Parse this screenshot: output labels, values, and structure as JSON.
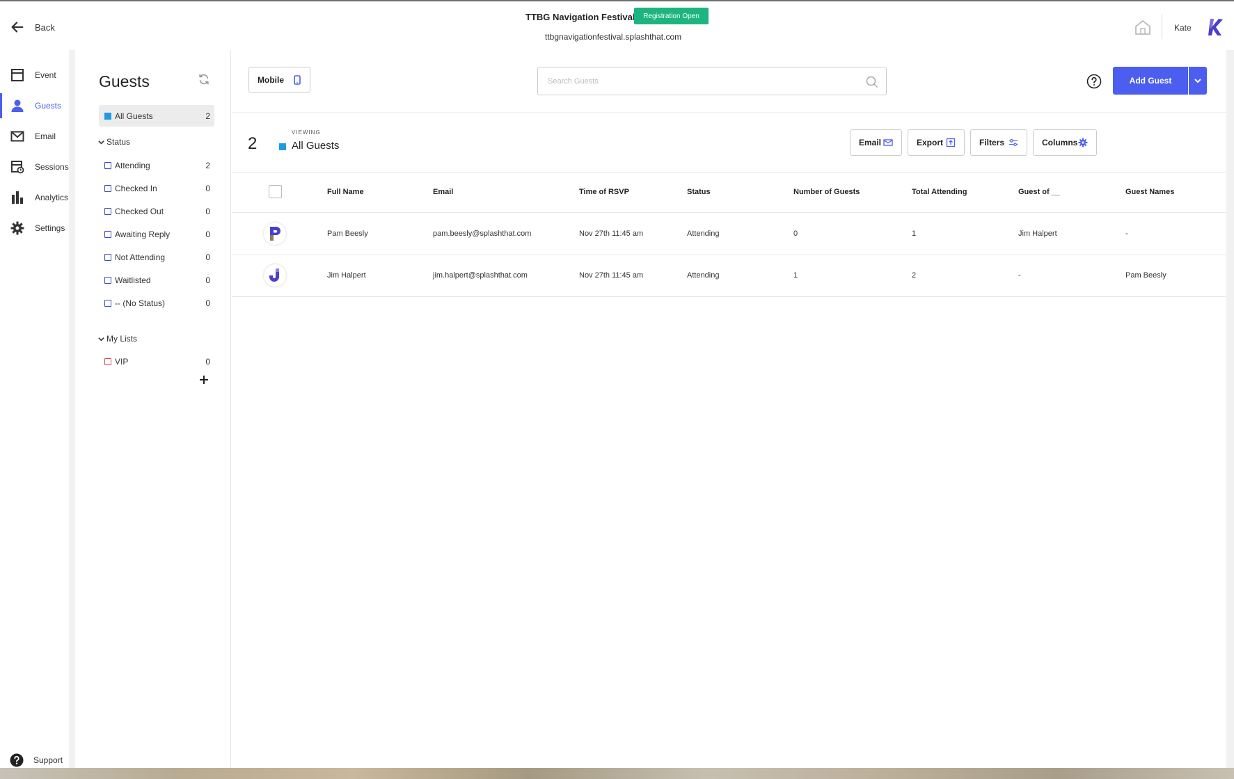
{
  "header": {
    "back_label": "Back",
    "event_title": "TTBG Navigation Festival",
    "registration_badge": "Registration Open",
    "event_url": "ttbgnavigationfestival.splashthat.com",
    "user_name": "Kate"
  },
  "nav": {
    "items": [
      {
        "label": "Event",
        "icon": "calendar-icon"
      },
      {
        "label": "Guests",
        "icon": "person-icon",
        "active": true
      },
      {
        "label": "Email",
        "icon": "mail-icon"
      },
      {
        "label": "Sessions",
        "icon": "sessions-icon"
      },
      {
        "label": "Analytics",
        "icon": "bar-chart-icon"
      },
      {
        "label": "Settings",
        "icon": "gear-icon"
      }
    ],
    "support_label": "Support"
  },
  "guests_panel": {
    "title": "Guests",
    "all": {
      "label": "All Guests",
      "count": "2"
    },
    "status_heading": "Status",
    "statuses": [
      {
        "label": "Attending",
        "count": "2"
      },
      {
        "label": "Checked In",
        "count": "0"
      },
      {
        "label": "Checked Out",
        "count": "0"
      },
      {
        "label": "Awaiting Reply",
        "count": "0"
      },
      {
        "label": "Not Attending",
        "count": "0"
      },
      {
        "label": "Waitlisted",
        "count": "0"
      },
      {
        "label": "-- (No Status)",
        "count": "0"
      }
    ],
    "lists_heading": "My Lists",
    "lists": [
      {
        "label": "VIP",
        "count": "0"
      }
    ]
  },
  "toolbar": {
    "mobile_label": "Mobile",
    "search_placeholder": "Search Guests",
    "add_guest_label": "Add Guest"
  },
  "view": {
    "count": "2",
    "viewing_label": "VIEWING",
    "list_name": "All Guests",
    "buttons": {
      "email": "Email",
      "export": "Export",
      "filters": "Filters",
      "columns": "Columns"
    }
  },
  "table": {
    "columns": [
      "Full Name",
      "Email",
      "Time of RSVP",
      "Status",
      "Number of Guests",
      "Total Attending",
      "Guest of __",
      "Guest Names"
    ],
    "rows": [
      {
        "initial": "P",
        "name": "Pam Beesly",
        "email": "pam.beesly@splashthat.com",
        "rsvp": "Nov 27th 11:45 am",
        "status": "Attending",
        "num_guests": "0",
        "total": "1",
        "guest_of": "Jim Halpert",
        "guest_names": "-"
      },
      {
        "initial": "J",
        "name": "Jim Halpert",
        "email": "jim.halpert@splashthat.com",
        "rsvp": "Nov 27th 11:45 am",
        "status": "Attending",
        "num_guests": "1",
        "total": "2",
        "guest_of": "-",
        "guest_names": "Pam Beesly"
      }
    ]
  },
  "colors": {
    "accent": "#4b5ef0",
    "badge_green": "#1db57f",
    "list_blue": "#1e9be6"
  }
}
